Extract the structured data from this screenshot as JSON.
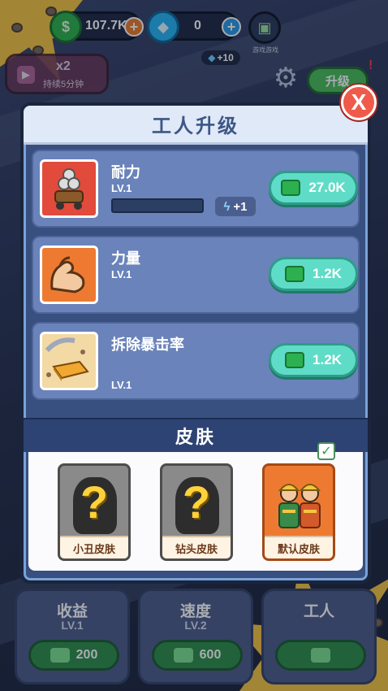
{
  "hud": {
    "cash": "107.7K",
    "gems": "0",
    "gem_bonus": "+10",
    "gamepad_label": "游戏游戏",
    "boost_multiplier": "x2",
    "boost_duration": "持续5分钟",
    "upgrade_button": "升级"
  },
  "panel": {
    "title": "工人升级",
    "close_symbol": "X",
    "upgrades": [
      {
        "name": "耐力",
        "level": "LV.1",
        "price": "27.0K",
        "progress": 0.0,
        "bonus": "+1"
      },
      {
        "name": "力量",
        "level": "LV.1",
        "price": "1.2K"
      },
      {
        "name": "拆除暴击率",
        "level": "LV.1",
        "price": "1.2K"
      }
    ],
    "skins_title": "皮肤",
    "skins": [
      {
        "name": "小丑皮肤",
        "unlocked": false,
        "selected": false
      },
      {
        "name": "钻头皮肤",
        "unlocked": false,
        "selected": false
      },
      {
        "name": "默认皮肤",
        "unlocked": true,
        "selected": true
      }
    ]
  },
  "bottom_stats": [
    {
      "title": "收益",
      "level": "LV.1",
      "price": "200"
    },
    {
      "title": "速度",
      "level": "LV.2",
      "price": "600"
    },
    {
      "title": "工人",
      "level": "",
      "price": ""
    }
  ],
  "colors": {
    "panel_bg": "#38507f",
    "row_bg": "#6a83ba",
    "buy_button": "#5fdcc7",
    "close_button": "#f05a4a",
    "accent_yellow": "#f5c542"
  }
}
